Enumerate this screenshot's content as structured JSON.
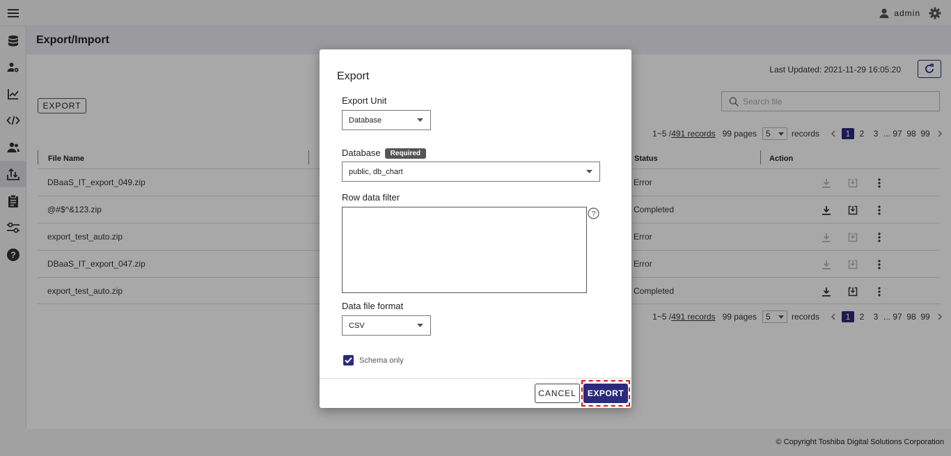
{
  "app": {
    "user": "admin",
    "icons": {
      "menu": "hamburger-icon",
      "user": "person-icon",
      "settings": "gear-icon"
    }
  },
  "sidebar": {
    "items": [
      {
        "icon": "database-icon"
      },
      {
        "icon": "user-settings-icon"
      },
      {
        "icon": "chart-icon"
      },
      {
        "icon": "code-icon"
      },
      {
        "icon": "users-icon"
      },
      {
        "icon": "export-import-icon",
        "active": true
      },
      {
        "icon": "clipboard-icon"
      },
      {
        "icon": "settings-sliders-icon"
      },
      {
        "icon": "help-icon"
      }
    ]
  },
  "page": {
    "title": "Export/Import",
    "last_updated": "Last Updated: 2021-11-29 16:05:20",
    "export_button": "EXPORT",
    "search_placeholder": "Search file"
  },
  "pagination": {
    "range": "1~5 / ",
    "records_link": "491 records",
    "pages": "99 pages",
    "per_page": "5",
    "records_label": "records",
    "pages_list": [
      "1",
      "2",
      "3",
      "97",
      "98",
      "99"
    ],
    "current": "1",
    "ellipsis": "..."
  },
  "table": {
    "headers": {
      "file_name": "File Name",
      "status": "Status",
      "action": "Action"
    },
    "rows": [
      {
        "file_name": "DBaaS_IT_export_049.zip",
        "status": "Error"
      },
      {
        "file_name": "@#$^&123.zip",
        "status": "Completed"
      },
      {
        "file_name": "export_test_auto.zip",
        "status": "Error"
      },
      {
        "file_name": "DBaaS_IT_export_047.zip",
        "status": "Error"
      },
      {
        "file_name": "export_test_auto.zip",
        "status": "Completed"
      }
    ]
  },
  "footer": {
    "copyright": "© Copyright Toshiba Digital Solutions Corporation"
  },
  "dialog": {
    "title": "Export",
    "export_unit_label": "Export Unit",
    "export_unit_value": "Database",
    "database_label": "Database",
    "required_badge": "Required",
    "database_value": "public, db_chart",
    "row_filter_label": "Row data filter",
    "row_filter_value": "",
    "format_label": "Data file format",
    "format_value": "CSV",
    "schema_only_label": "Schema only",
    "schema_only_checked": true,
    "cancel_label": "CANCEL",
    "export_label": "EXPORT"
  },
  "colors": {
    "primary": "#2c2a7c",
    "highlight": "#e01010"
  }
}
